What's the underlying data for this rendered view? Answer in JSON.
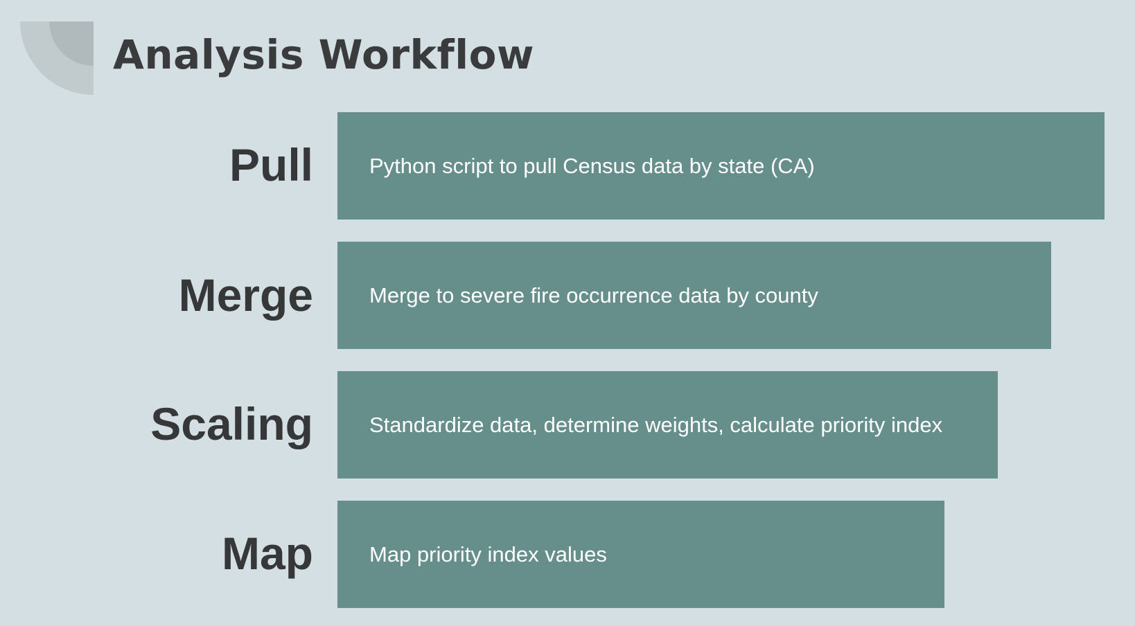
{
  "title": "Analysis Workflow",
  "steps": [
    {
      "label": "Pull",
      "description": "Python script to pull Census data by state (CA)"
    },
    {
      "label": "Merge",
      "description": "Merge to severe fire occurrence data by county"
    },
    {
      "label": "Scaling",
      "description": "Standardize data, determine weights, calculate priority index"
    },
    {
      "label": "Map",
      "description": "Map priority index values"
    }
  ],
  "colors": {
    "background": "#d3dfe3",
    "bar": "#668f8c",
    "label_text": "#363739",
    "bar_text": "#ffffff"
  }
}
